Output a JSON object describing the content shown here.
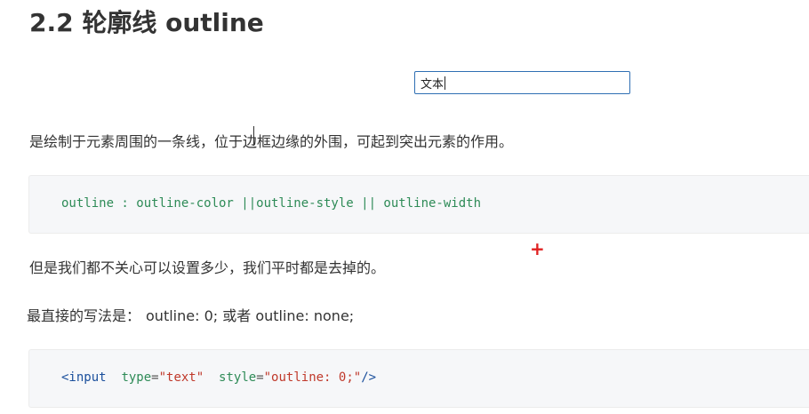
{
  "title": "2.2 轮廓线 outline",
  "demo_input": {
    "value": "文本"
  },
  "paragraphs": {
    "p1": "是绘制于元素周围的一条线，位于边框边缘的外围，可起到突出元素的作用。",
    "p2": "但是我们都不关心可以设置多少，我们平时都是去掉的。",
    "p3_label": "最直接的写法是：",
    "p3_code": "outline: 0;  或者  outline: none;"
  },
  "code_block_1": {
    "line": "outline : outline-color ||outline-style || outline-width"
  },
  "code_block_2": {
    "tag_open": "<input",
    "attr1_name": "type",
    "attr1_eq": "=",
    "attr1_val": "\"text\"",
    "attr2_name": "style",
    "attr2_eq": "=",
    "attr2_val": "\"outline: 0;\"",
    "tag_close": "/>"
  },
  "colors": {
    "input_border": "#2f6fb3",
    "code_bg": "#f6f7f9",
    "code_keyword": "#2e8b57",
    "code_tag": "#1a4f9c",
    "code_string": "#c0392b",
    "cursor_plus": "#e02020"
  },
  "icons": {
    "cursor": "crosshair-plus-icon"
  }
}
